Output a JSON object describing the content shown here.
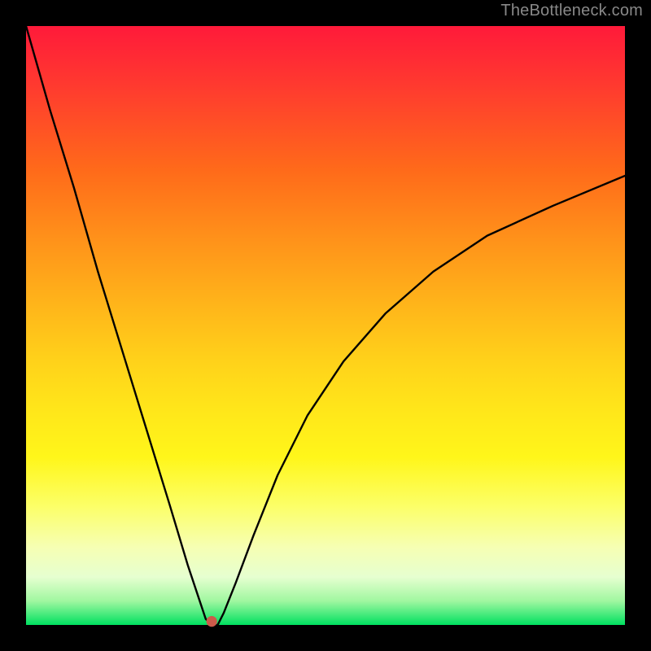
{
  "attribution": "TheBottleneck.com",
  "chart_data": {
    "type": "line",
    "title": "",
    "xlabel": "",
    "ylabel": "",
    "xlim": [
      0,
      100
    ],
    "ylim": [
      0,
      100
    ],
    "series": [
      {
        "name": "bottleneck-curve",
        "x": [
          0,
          4,
          8,
          12,
          16,
          20,
          24,
          27,
          29,
          30,
          31,
          32,
          33,
          35,
          38,
          42,
          47,
          53,
          60,
          68,
          77,
          88,
          100
        ],
        "y": [
          100,
          86,
          73,
          59,
          46,
          33,
          20,
          10,
          4,
          1,
          0,
          0,
          2,
          7,
          15,
          25,
          35,
          44,
          52,
          59,
          65,
          70,
          75
        ]
      }
    ],
    "marker": {
      "x": 31,
      "y": 0.6,
      "color": "#cc5a4a",
      "radius_pct": 0.9
    },
    "background_gradient": {
      "type": "vertical",
      "stops": [
        {
          "pct": 0,
          "color": "#ff1a3a"
        },
        {
          "pct": 50,
          "color": "#ffcc1a"
        },
        {
          "pct": 85,
          "color": "#faff99"
        },
        {
          "pct": 100,
          "color": "#00e060"
        }
      ]
    }
  }
}
